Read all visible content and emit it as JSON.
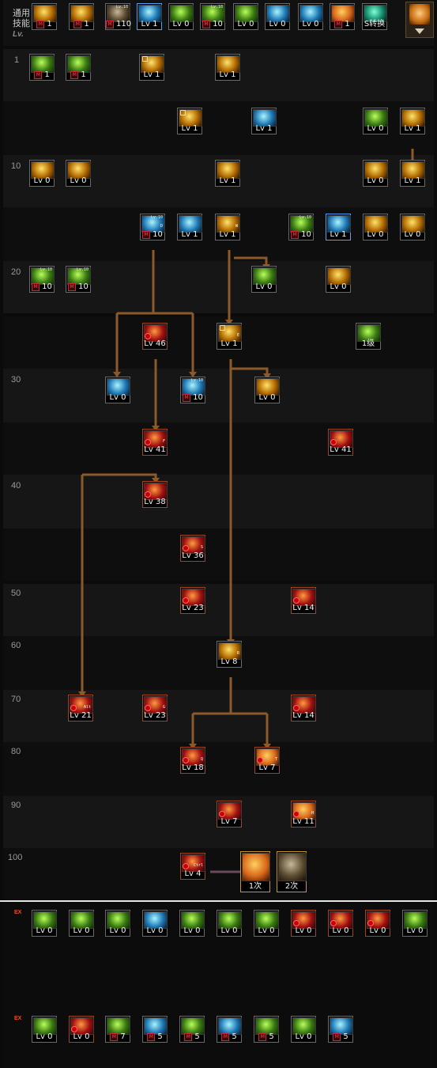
{
  "general": {
    "label_line1": "通用",
    "label_line2": "技能",
    "lv_mark": "Lv.",
    "skills": [
      {
        "id": "g1",
        "color": "yellow",
        "label": "1",
        "m": true
      },
      {
        "id": "g2",
        "color": "yellow",
        "label": "1",
        "m": true
      },
      {
        "id": "g3",
        "color": "gray",
        "label": "110",
        "m": true,
        "top": "Lv.10"
      },
      {
        "id": "g4",
        "color": "cyan",
        "label": "Lv 1",
        "sel": true
      },
      {
        "id": "g5",
        "color": "green",
        "label": "Lv 0"
      },
      {
        "id": "g6",
        "color": "green",
        "label": "10",
        "m": true,
        "top": "Lv.10"
      },
      {
        "id": "g7",
        "color": "green",
        "label": "Lv 0"
      },
      {
        "id": "g8",
        "color": "cyan",
        "label": "Lv 0"
      },
      {
        "id": "g9",
        "color": "cyan",
        "label": "Lv 0"
      },
      {
        "id": "g10",
        "color": "orange",
        "label": "1",
        "m": true
      },
      {
        "id": "g11",
        "color": "teal",
        "label": "S转换"
      }
    ]
  },
  "tree": {
    "level_rows": [
      "1",
      "10",
      "20",
      "30",
      "40",
      "50",
      "60",
      "70",
      "80",
      "90",
      "100"
    ],
    "skills": [
      {
        "id": "t1",
        "color": "green",
        "label": "1",
        "m": true
      },
      {
        "id": "t2",
        "color": "green",
        "label": "1",
        "m": true
      },
      {
        "id": "t3",
        "color": "yellow",
        "label": "Lv 1",
        "lock": true
      },
      {
        "id": "t4",
        "color": "yellow",
        "label": "Lv 1"
      },
      {
        "id": "t5",
        "color": "yellow",
        "label": "Lv 1",
        "lock": true
      },
      {
        "id": "t6",
        "color": "cyan",
        "label": "Lv 1"
      },
      {
        "id": "t7",
        "color": "green",
        "label": "Lv 0"
      },
      {
        "id": "t8",
        "color": "yellow",
        "label": "Lv 1"
      },
      {
        "id": "t9",
        "color": "yellow",
        "label": "Lv 0"
      },
      {
        "id": "t10",
        "color": "yellow",
        "label": "Lv 0"
      },
      {
        "id": "t11",
        "color": "yellow",
        "label": "Lv 1"
      },
      {
        "id": "t12",
        "color": "yellow",
        "label": "Lv 0"
      },
      {
        "id": "t13",
        "color": "yellow",
        "label": "Lv 1"
      },
      {
        "id": "t14",
        "color": "cyan",
        "label": "10",
        "m": true,
        "tag": "D",
        "top": "Lv.10"
      },
      {
        "id": "t15",
        "color": "cyan",
        "label": "Lv 1"
      },
      {
        "id": "t16",
        "color": "yellow",
        "label": "Lv 1",
        "tag": "W"
      },
      {
        "id": "t17",
        "color": "green",
        "label": "10",
        "m": true,
        "top": "Lv.10"
      },
      {
        "id": "t18",
        "color": "cyan",
        "label": "Lv 1",
        "sel": true
      },
      {
        "id": "t19",
        "color": "yellow",
        "label": "Lv 0"
      },
      {
        "id": "t20",
        "color": "yellow",
        "label": "Lv 0"
      },
      {
        "id": "t21",
        "color": "green",
        "label": "10",
        "m": true,
        "top": "Lv.10"
      },
      {
        "id": "t22",
        "color": "green",
        "label": "10",
        "m": true,
        "top": "Lv.10"
      },
      {
        "id": "t23",
        "color": "green",
        "label": "Lv 0"
      },
      {
        "id": "t24",
        "color": "yellow",
        "label": "Lv 0"
      },
      {
        "id": "t25",
        "color": "red",
        "label": "Lv 46",
        "awake": true
      },
      {
        "id": "t26",
        "color": "yellow",
        "label": "Lv 1",
        "lock": true,
        "tag": "E"
      },
      {
        "id": "t27",
        "color": "green",
        "label": "1级"
      },
      {
        "id": "t28",
        "color": "cyan",
        "label": "Lv 0"
      },
      {
        "id": "t29",
        "color": "cyan",
        "label": "10",
        "m": true,
        "top": "Lv.10"
      },
      {
        "id": "t30",
        "color": "yellow",
        "label": "Lv 0"
      },
      {
        "id": "t31",
        "color": "red",
        "label": "Lv 41",
        "awake": true,
        "tag": "F"
      },
      {
        "id": "t32",
        "color": "red",
        "label": "Lv 41",
        "awake": true
      },
      {
        "id": "t33",
        "color": "red",
        "label": "Lv 38",
        "awake": true
      },
      {
        "id": "t34",
        "color": "red",
        "label": "Lv 36",
        "awake": true,
        "tag": "S"
      },
      {
        "id": "t35",
        "color": "red",
        "label": "Lv 23",
        "awake": true
      },
      {
        "id": "t36",
        "color": "red",
        "label": "Lv 14",
        "awake": true
      },
      {
        "id": "t37",
        "color": "yellow",
        "label": "Lv 8",
        "tag": "R"
      },
      {
        "id": "t38",
        "color": "red",
        "label": "Lv 21",
        "awake": true,
        "tag": "Alt"
      },
      {
        "id": "t39",
        "color": "red",
        "label": "Lv 23",
        "awake": true,
        "tag": "G"
      },
      {
        "id": "t40",
        "color": "red",
        "label": "Lv 14",
        "awake": true
      },
      {
        "id": "t41",
        "color": "red",
        "label": "Lv 18",
        "awake": true,
        "tag": "Q"
      },
      {
        "id": "t42",
        "color": "orange",
        "label": "Lv 7",
        "awake": true,
        "tag": "T"
      },
      {
        "id": "t43",
        "color": "red",
        "label": "Lv 7",
        "awake": true
      },
      {
        "id": "t44",
        "color": "orange",
        "label": "Lv 11",
        "awake": true,
        "tag": "H"
      },
      {
        "id": "t45",
        "color": "red",
        "label": "Lv 4",
        "awake": true,
        "tag": "Ctrl"
      },
      {
        "id": "t46",
        "color": "orange",
        "label": "1次",
        "gold": true
      },
      {
        "id": "t47",
        "color": "gray",
        "label": "2次",
        "gold": true
      }
    ]
  },
  "ex": {
    "mark": "EX",
    "row1": [
      {
        "id": "e1",
        "color": "green",
        "label": "Lv 0"
      },
      {
        "id": "e2",
        "color": "green",
        "label": "Lv 0"
      },
      {
        "id": "e3",
        "color": "green",
        "label": "Lv 0"
      },
      {
        "id": "e4",
        "color": "cyan",
        "label": "Lv 0"
      },
      {
        "id": "e5",
        "color": "green",
        "label": "Lv 0"
      },
      {
        "id": "e6",
        "color": "green",
        "label": "Lv 0"
      },
      {
        "id": "e7",
        "color": "green",
        "label": "Lv 0"
      },
      {
        "id": "e8",
        "color": "red",
        "label": "Lv 0",
        "awake": true
      },
      {
        "id": "e9",
        "color": "red",
        "label": "Lv 0",
        "awake": true
      },
      {
        "id": "e10",
        "color": "red",
        "label": "Lv 0",
        "awake": true
      },
      {
        "id": "e11",
        "color": "green",
        "label": "Lv 0"
      }
    ],
    "row2": [
      {
        "id": "f1",
        "color": "green",
        "label": "Lv 0"
      },
      {
        "id": "f2",
        "color": "red",
        "label": "Lv 0",
        "awake": true
      },
      {
        "id": "f3",
        "color": "green",
        "label": "7",
        "m": true
      },
      {
        "id": "f4",
        "color": "cyan",
        "label": "5",
        "m": true
      },
      {
        "id": "f5",
        "color": "green",
        "label": "5",
        "m": true
      },
      {
        "id": "f6",
        "color": "cyan",
        "label": "5",
        "m": true
      },
      {
        "id": "f7",
        "color": "green",
        "label": "5",
        "m": true
      },
      {
        "id": "f8",
        "color": "green",
        "label": "Lv 0"
      },
      {
        "id": "f9",
        "color": "cyan",
        "label": "5",
        "m": true
      }
    ]
  }
}
